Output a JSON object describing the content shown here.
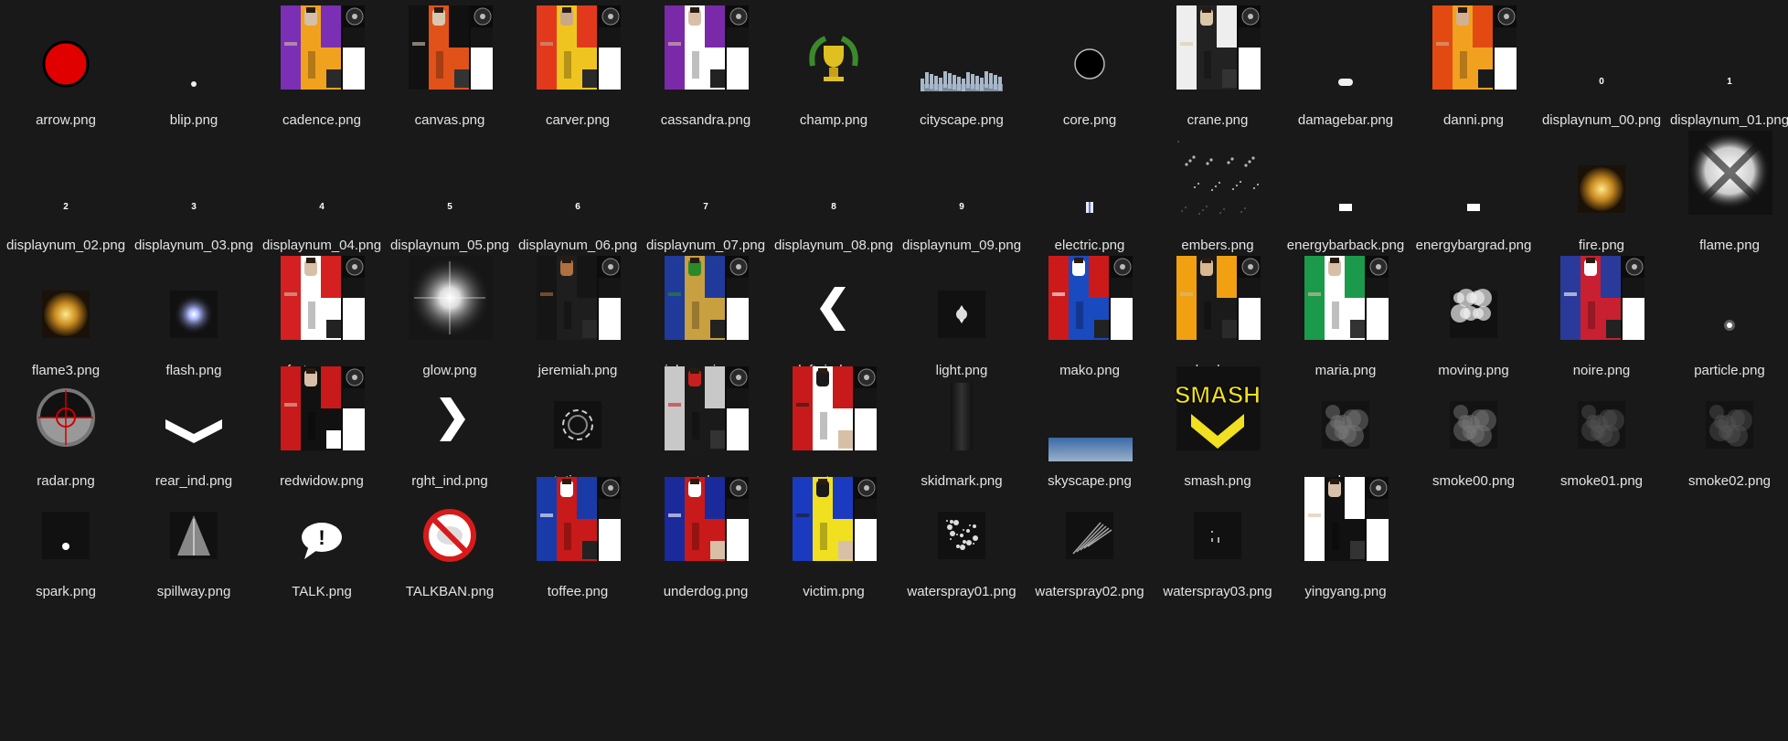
{
  "window": {
    "background": "#191919",
    "view_mode": "large icons"
  },
  "files": [
    {
      "name": "arrow.png",
      "kind": "circle-red"
    },
    {
      "name": "blip.png",
      "kind": "dot"
    },
    {
      "name": "cadence.png",
      "kind": "skin",
      "colors": [
        "#7b2fb5",
        "#f0a21e",
        "#d4c0a8",
        "#2a2a2a"
      ]
    },
    {
      "name": "canvas.png",
      "kind": "skin",
      "colors": [
        "#111111",
        "#e0521a",
        "#d8c8b0",
        "#333333"
      ]
    },
    {
      "name": "carver.png",
      "kind": "skin",
      "colors": [
        "#e2391c",
        "#f0c420",
        "#c8a888",
        "#2a2a2a"
      ]
    },
    {
      "name": "cassandra.png",
      "kind": "skin",
      "colors": [
        "#7a2aa8",
        "#ffffff",
        "#d8c0a8",
        "#222222"
      ]
    },
    {
      "name": "champ.png",
      "kind": "trophy"
    },
    {
      "name": "cityscape.png",
      "kind": "city"
    },
    {
      "name": "core.png",
      "kind": "ring"
    },
    {
      "name": "crane.png",
      "kind": "skin",
      "colors": [
        "#eeeeee",
        "#222222",
        "#d8c8a8",
        "#333333"
      ]
    },
    {
      "name": "damagebar.png",
      "kind": "pill"
    },
    {
      "name": "danni.png",
      "kind": "skin",
      "colors": [
        "#e24a12",
        "#f2a020",
        "#d2b090",
        "#1a1a1a"
      ]
    },
    {
      "name": "displaynum_00.png",
      "kind": "digit",
      "digit": "0"
    },
    {
      "name": "displaynum_01.png",
      "kind": "digit",
      "digit": "1"
    },
    {
      "name": "displaynum_02.png",
      "kind": "digit",
      "digit": "2"
    },
    {
      "name": "displaynum_03.png",
      "kind": "digit",
      "digit": "3"
    },
    {
      "name": "displaynum_04.png",
      "kind": "digit",
      "digit": "4"
    },
    {
      "name": "displaynum_05.png",
      "kind": "digit",
      "digit": "5"
    },
    {
      "name": "displaynum_06.png",
      "kind": "digit",
      "digit": "6"
    },
    {
      "name": "displaynum_07.png",
      "kind": "digit",
      "digit": "7"
    },
    {
      "name": "displaynum_08.png",
      "kind": "digit",
      "digit": "8"
    },
    {
      "name": "displaynum_09.png",
      "kind": "digit",
      "digit": "9"
    },
    {
      "name": "electric.png",
      "kind": "electric"
    },
    {
      "name": "embers.png",
      "kind": "embers"
    },
    {
      "name": "energybarback.png",
      "kind": "bar-small"
    },
    {
      "name": "energybargrad.png",
      "kind": "bar-small"
    },
    {
      "name": "fire.png",
      "kind": "fire"
    },
    {
      "name": "flame.png",
      "kind": "flame-white"
    },
    {
      "name": "flame3.png",
      "kind": "fire"
    },
    {
      "name": "flash.png",
      "kind": "flash"
    },
    {
      "name": "fortune.png",
      "kind": "skin",
      "colors": [
        "#d42020",
        "#ffffff",
        "#d8c0a8",
        "#222222"
      ]
    },
    {
      "name": "glow.png",
      "kind": "glow"
    },
    {
      "name": "jeremiah.png",
      "kind": "skin",
      "colors": [
        "#151515",
        "#1e1e1e",
        "#b07040",
        "#2a2a2a"
      ]
    },
    {
      "name": "johnsonjr.png",
      "kind": "skin",
      "colors": [
        "#1f3a9a",
        "#c8a040",
        "#2a8a2a",
        "#222222"
      ]
    },
    {
      "name": "left_ind.png",
      "kind": "chevron-left"
    },
    {
      "name": "light.png",
      "kind": "light"
    },
    {
      "name": "mako.png",
      "kind": "skin",
      "colors": [
        "#cc1a1a",
        "#1a4ac0",
        "#ffffff",
        "#222222"
      ]
    },
    {
      "name": "makucha.png",
      "kind": "skin",
      "colors": [
        "#f0a010",
        "#1a1a1a",
        "#d8b890",
        "#2a2a2a"
      ]
    },
    {
      "name": "maria.png",
      "kind": "skin",
      "colors": [
        "#1a9a4a",
        "#ffffff",
        "#d8c0a8",
        "#333333"
      ]
    },
    {
      "name": "moving.png",
      "kind": "smoke-white"
    },
    {
      "name": "noire.png",
      "kind": "skin",
      "colors": [
        "#2a3a9a",
        "#c82030",
        "#ffffff",
        "#222222"
      ]
    },
    {
      "name": "particle.png",
      "kind": "particle"
    },
    {
      "name": "radar.png",
      "kind": "radar"
    },
    {
      "name": "rear_ind.png",
      "kind": "chevron-down"
    },
    {
      "name": "redwidow.png",
      "kind": "skin",
      "colors": [
        "#c81a1a",
        "#111111",
        "#d8c0a8",
        "#ffffff"
      ]
    },
    {
      "name": "rght_ind.png",
      "kind": "chevron-right"
    },
    {
      "name": "rotating.png",
      "kind": "swirl"
    },
    {
      "name": "scratch.png",
      "kind": "skin",
      "colors": [
        "#c8c8c8",
        "#1a1a1a",
        "#c82020",
        "#333333"
      ]
    },
    {
      "name": "set.png",
      "kind": "skin",
      "colors": [
        "#c81a1a",
        "#ffffff",
        "#1a1a1a",
        "#d8c0a8"
      ]
    },
    {
      "name": "skidmark.png",
      "kind": "skid"
    },
    {
      "name": "skyscape.png",
      "kind": "sky"
    },
    {
      "name": "smash.png",
      "kind": "smash",
      "text": "SMASH"
    },
    {
      "name": "smoke.png",
      "kind": "smoke"
    },
    {
      "name": "smoke00.png",
      "kind": "smoke"
    },
    {
      "name": "smoke01.png",
      "kind": "smoke-dim"
    },
    {
      "name": "smoke02.png",
      "kind": "smoke-dim"
    },
    {
      "name": "spark.png",
      "kind": "spark"
    },
    {
      "name": "spillway.png",
      "kind": "spillway"
    },
    {
      "name": "TALK.png",
      "kind": "talk"
    },
    {
      "name": "TALKBAN.png",
      "kind": "talkban"
    },
    {
      "name": "toffee.png",
      "kind": "skin",
      "colors": [
        "#1a3aa8",
        "#c81a1a",
        "#ffffff",
        "#222222"
      ]
    },
    {
      "name": "underdog.png",
      "kind": "skin",
      "colors": [
        "#1a2a9a",
        "#c81a1a",
        "#ffffff",
        "#d8c0a8"
      ]
    },
    {
      "name": "victim.png",
      "kind": "skin",
      "colors": [
        "#1a3ac0",
        "#f0e020",
        "#1a1a1a",
        "#d8c0a8"
      ]
    },
    {
      "name": "waterspray01.png",
      "kind": "spray1"
    },
    {
      "name": "waterspray02.png",
      "kind": "spray2"
    },
    {
      "name": "waterspray03.png",
      "kind": "spray3"
    },
    {
      "name": "yingyang.png",
      "kind": "skin",
      "colors": [
        "#ffffff",
        "#111111",
        "#d8c0a8",
        "#333333"
      ]
    }
  ]
}
